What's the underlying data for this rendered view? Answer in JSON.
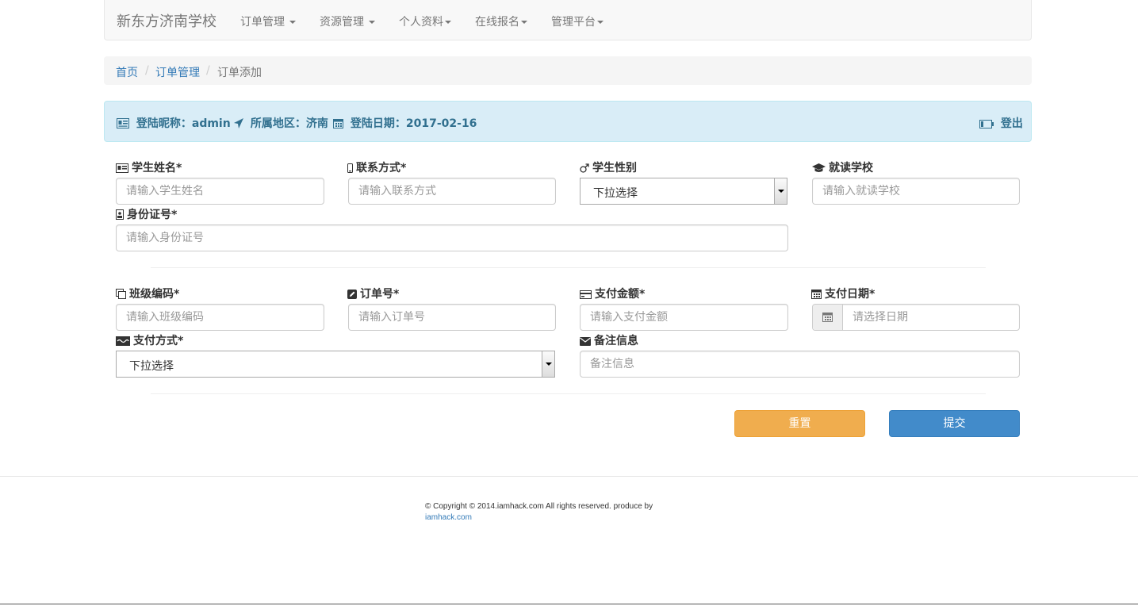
{
  "navbar": {
    "brand": "新东方济南学校",
    "items": [
      "订单管理",
      "资源管理",
      "个人资料",
      "在线报名",
      "管理平台"
    ]
  },
  "breadcrumb": {
    "home": "首页",
    "section": "订单管理",
    "current": "订单添加",
    "separator": "/"
  },
  "user_info": {
    "nickname": "登陆昵称：admin",
    "region": "所属地区：济南",
    "login_date": "登陆日期：2017-02-16",
    "logout": "登出"
  },
  "student": {
    "name_label": "学生姓名*",
    "name_placeholder": "请输入学生姓名",
    "contact_label": "联系方式*",
    "contact_placeholder": "请输入联系方式",
    "gender_label": "学生性别",
    "gender_value": "下拉选择",
    "school_label": "就读学校",
    "school_placeholder": "请输入就读学校",
    "id_label": "身份证号*",
    "id_placeholder": "请输入身份证号"
  },
  "order": {
    "class_label": "班级编码*",
    "class_placeholder": "请输入班级编码",
    "order_no_label": "订单号*",
    "order_no_placeholder": "请输入订单号",
    "amount_label": "支付金额*",
    "amount_placeholder": "请输入支付金额",
    "date_label": "支付日期*",
    "date_placeholder": "请选择日期",
    "method_label": "支付方式*",
    "method_value": "下拉选择",
    "remark_label": "备注信息",
    "remark_placeholder": "备注信息"
  },
  "actions": {
    "reset": "重置",
    "submit": "提交"
  },
  "footer": {
    "copyright": "© Copyright © 2014.iamhack.com All rights reserved. produce by",
    "link": "iamhack.com"
  },
  "colors": {
    "primary": "#428bca",
    "warning": "#f0ad4e",
    "info_bg": "#d9edf7",
    "info_text": "#31708f",
    "link": "#337ab7"
  }
}
